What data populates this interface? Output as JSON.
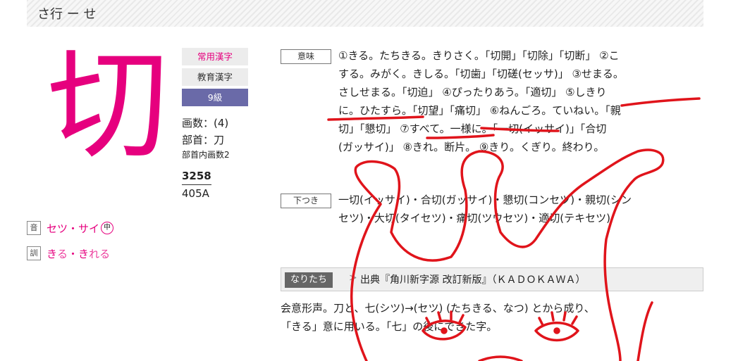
{
  "header": {
    "title": "さ行 ー せ"
  },
  "kanji": {
    "character": "切",
    "badges": {
      "joyo": "常用漢字",
      "kyoiku": "教育漢字",
      "level": "9級"
    },
    "strokes": "画数：(4)",
    "radical": "部首：刀",
    "radical_strokes": "部首内画数2",
    "code1": "3258",
    "code2": "405A",
    "on_reading": {
      "tag": "音",
      "text": "セツ・サイ",
      "mark": "中"
    },
    "kun_reading": {
      "tag": "訓",
      "root1": "き",
      "okurigana1": "る",
      "sep": "・",
      "root2": "き",
      "okurigana2": "れる"
    }
  },
  "meaning": {
    "label": "意味",
    "lines": [
      "①きる。たちきる。きりさく。「切開」「切除」「切断」 ②こ",
      "する。みがく。きしる。「切歯」「切磋(セッサ)」 ③せまる。",
      "さしせまる。「切迫」 ④ぴったりあう。「適切」 ⑤しきり",
      "に。ひたすら。「切望」「痛切」 ⑥ねんごろ。ていねい。「親",
      "切」「懇切」 ⑦すべて。一様に。「一切(イッサイ)」「合切",
      "(ガッサイ)」 ⑧きれ。断片。 ⑨きり。くぎり。終わり。"
    ]
  },
  "shitatsuki": {
    "label": "下つき",
    "lines": [
      "一切(イッサイ)・合切(ガッサイ)・懇切(コンセツ)・親切(シン",
      "セツ)・大切(タイセツ)・痛切(ツウセツ)・適切(テキセツ)"
    ]
  },
  "origin": {
    "tag": "なりたち",
    "arrow": ">",
    "source": "出典『角川新字源 改訂新版』（ＫＡＤＯＫＡＷＡ）",
    "lines": [
      "会意形声。刀と、七(シツ)→(セツ) (たちきる、なつ) とから成り、",
      "「きる」意に用いる。「七」の後にできた字。"
    ]
  },
  "colors": {
    "accent": "#e6007e",
    "level_badge": "#6a6aa8",
    "scribble": "#e0141b"
  }
}
